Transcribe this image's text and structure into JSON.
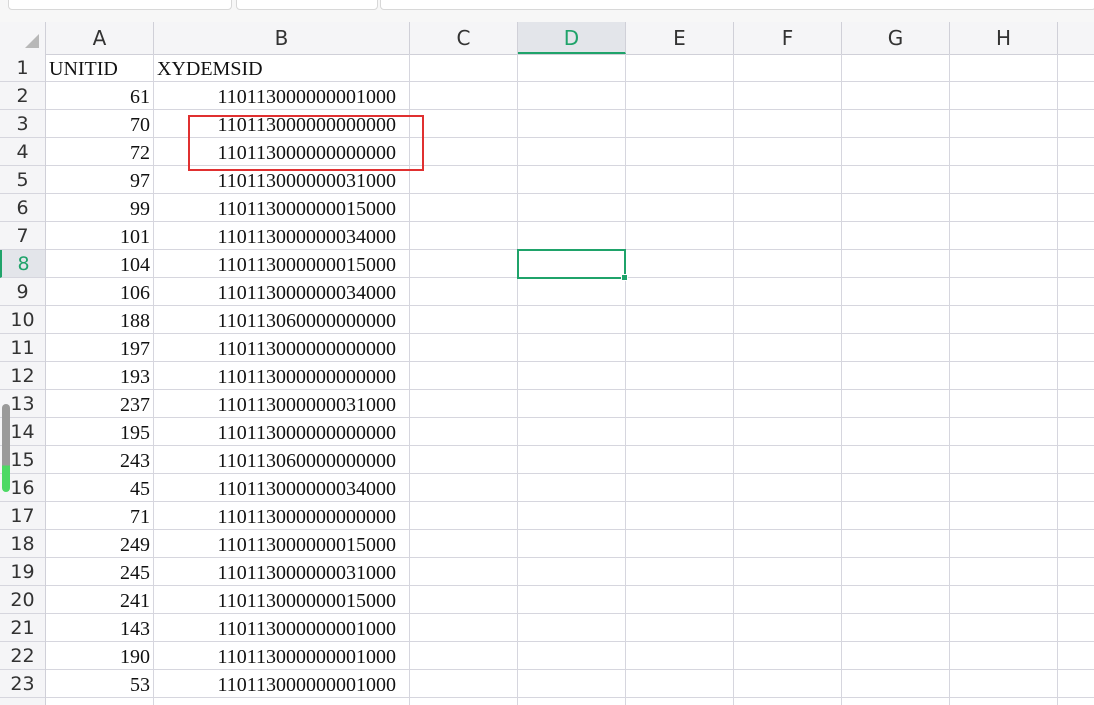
{
  "columns": [
    "A",
    "B",
    "C",
    "D",
    "E",
    "F",
    "G",
    "H"
  ],
  "active_column": "D",
  "active_row": "8",
  "rows": [
    {
      "num": "1",
      "a": "UNITID",
      "b": "XYDEMSID"
    },
    {
      "num": "2",
      "a": "61",
      "b": "110113000000001000"
    },
    {
      "num": "3",
      "a": "70",
      "b": "110113000000000000"
    },
    {
      "num": "4",
      "a": "72",
      "b": "110113000000000000"
    },
    {
      "num": "5",
      "a": "97",
      "b": "110113000000031000"
    },
    {
      "num": "6",
      "a": "99",
      "b": "110113000000015000"
    },
    {
      "num": "7",
      "a": "101",
      "b": "110113000000034000"
    },
    {
      "num": "8",
      "a": "104",
      "b": "110113000000015000"
    },
    {
      "num": "9",
      "a": "106",
      "b": "110113000000034000"
    },
    {
      "num": "10",
      "a": "188",
      "b": "110113060000000000"
    },
    {
      "num": "11",
      "a": "197",
      "b": "110113000000000000"
    },
    {
      "num": "12",
      "a": "193",
      "b": "110113000000000000"
    },
    {
      "num": "13",
      "a": "237",
      "b": "110113000000031000"
    },
    {
      "num": "14",
      "a": "195",
      "b": "110113000000000000"
    },
    {
      "num": "15",
      "a": "243",
      "b": "110113060000000000"
    },
    {
      "num": "16",
      "a": "45",
      "b": "110113000000034000"
    },
    {
      "num": "17",
      "a": "71",
      "b": "110113000000000000"
    },
    {
      "num": "18",
      "a": "249",
      "b": "110113000000015000"
    },
    {
      "num": "19",
      "a": "245",
      "b": "110113000000031000"
    },
    {
      "num": "20",
      "a": "241",
      "b": "110113000000015000"
    },
    {
      "num": "21",
      "a": "143",
      "b": "110113000000001000"
    },
    {
      "num": "22",
      "a": "190",
      "b": "110113000000001000"
    },
    {
      "num": "23",
      "a": "53",
      "b": "110113000000001000"
    }
  ],
  "colors": {
    "accent_green": "#1fa36a",
    "highlight_red": "#e03030",
    "header_bg": "#f5f5f7",
    "gridline": "#d6d6de"
  },
  "icons": {
    "select_all_corner": "select-all-triangle-icon"
  }
}
